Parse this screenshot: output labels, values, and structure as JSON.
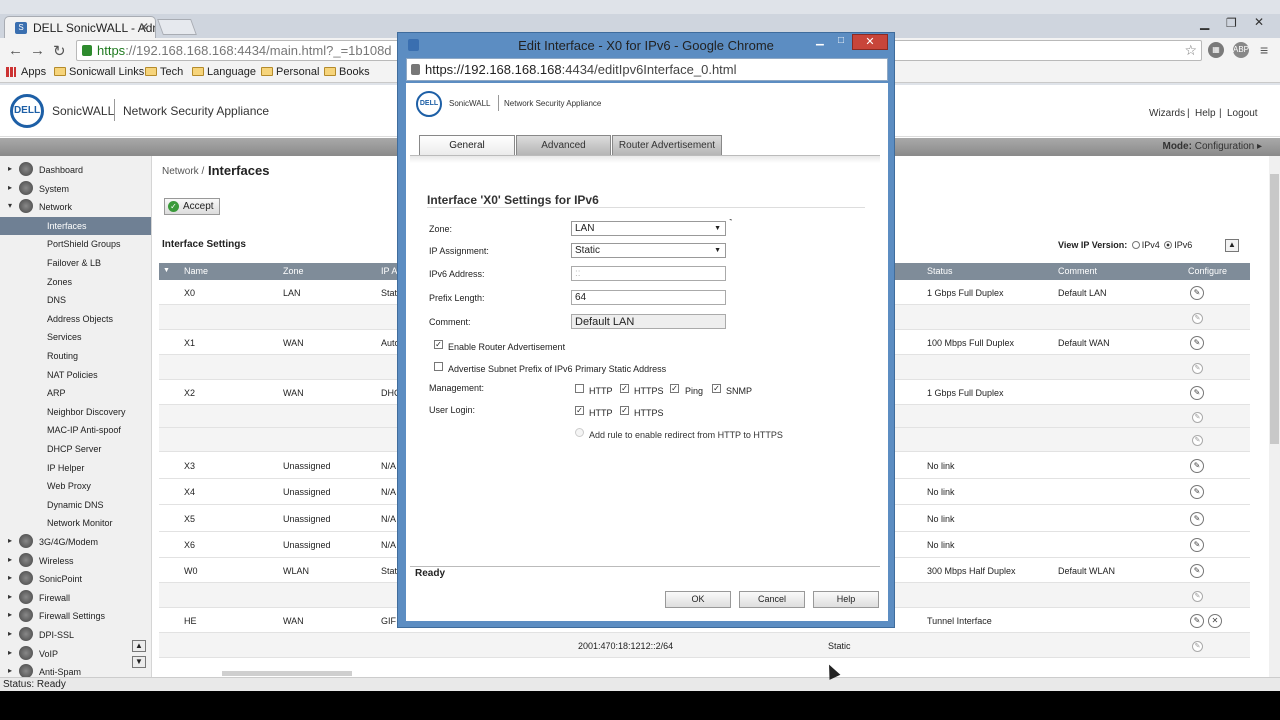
{
  "browser": {
    "tab_title": "DELL SonicWALL - Admin",
    "url_https": "https",
    "url_rest": "://192.168.168.168:4434/main.html?_=1b108d",
    "bookmarks": [
      "Apps",
      "Sonicwall Links",
      "Tech",
      "Language",
      "Personal",
      "Books"
    ]
  },
  "header": {
    "brand": "SonicWALL",
    "app_name": "Network Security Appliance",
    "links": [
      "Wizards",
      "Help",
      "Logout"
    ],
    "mode_label": "Mode:",
    "mode_value": "Configuration ▸"
  },
  "sidebar": {
    "items": [
      {
        "label": "Dashboard",
        "level": "top",
        "arrow": "▸"
      },
      {
        "label": "System",
        "level": "top",
        "arrow": "▸"
      },
      {
        "label": "Network",
        "level": "top",
        "arrow": "▾"
      },
      {
        "label": "Interfaces",
        "level": "sub",
        "selected": true
      },
      {
        "label": "PortShield Groups",
        "level": "sub"
      },
      {
        "label": "Failover & LB",
        "level": "sub"
      },
      {
        "label": "Zones",
        "level": "sub"
      },
      {
        "label": "DNS",
        "level": "sub"
      },
      {
        "label": "Address Objects",
        "level": "sub"
      },
      {
        "label": "Services",
        "level": "sub"
      },
      {
        "label": "Routing",
        "level": "sub"
      },
      {
        "label": "NAT Policies",
        "level": "sub"
      },
      {
        "label": "ARP",
        "level": "sub"
      },
      {
        "label": "Neighbor Discovery",
        "level": "sub"
      },
      {
        "label": "MAC-IP Anti-spoof",
        "level": "sub"
      },
      {
        "label": "DHCP Server",
        "level": "sub"
      },
      {
        "label": "IP Helper",
        "level": "sub"
      },
      {
        "label": "Web Proxy",
        "level": "sub"
      },
      {
        "label": "Dynamic DNS",
        "level": "sub"
      },
      {
        "label": "Network Monitor",
        "level": "sub"
      },
      {
        "label": "3G/4G/Modem",
        "level": "top",
        "arrow": "▸"
      },
      {
        "label": "Wireless",
        "level": "top",
        "arrow": "▸"
      },
      {
        "label": "SonicPoint",
        "level": "top",
        "arrow": "▸"
      },
      {
        "label": "Firewall",
        "level": "top",
        "arrow": "▸"
      },
      {
        "label": "Firewall Settings",
        "level": "top",
        "arrow": "▸"
      },
      {
        "label": "DPI-SSL",
        "level": "top",
        "arrow": "▸"
      },
      {
        "label": "VoIP",
        "level": "top",
        "arrow": "▸"
      },
      {
        "label": "Anti-Spam",
        "level": "top",
        "arrow": "▸"
      }
    ]
  },
  "main": {
    "breadcrumb": "Network /",
    "title": "Interfaces",
    "accept_label": "Accept",
    "section_title": "Interface Settings",
    "view_ip_label": "View IP Version:",
    "ipv4_label": "IPv4",
    "ipv6_label": "IPv6",
    "columns": [
      "Name",
      "Zone",
      "IP A",
      "Status",
      "Comment",
      "Configure"
    ],
    "rows": [
      {
        "name": "X0",
        "zone": "LAN",
        "ip": "Stati",
        "status": "1 Gbps Full Duplex",
        "comment": "Default LAN"
      },
      {
        "name": "",
        "zone": "",
        "ip": "",
        "status": "",
        "comment": ""
      },
      {
        "name": "X1",
        "zone": "WAN",
        "ip": "Auto",
        "status": "100 Mbps Full Duplex",
        "comment": "Default WAN"
      },
      {
        "name": "",
        "zone": "",
        "ip": "",
        "status": "",
        "comment": ""
      },
      {
        "name": "X2",
        "zone": "WAN",
        "ip": "DHC",
        "status": "1 Gbps Full Duplex",
        "comment": ""
      },
      {
        "name": "",
        "zone": "",
        "ip": "",
        "status": "",
        "comment": ""
      },
      {
        "name": "",
        "zone": "",
        "ip": "",
        "status": "",
        "comment": ""
      },
      {
        "name": "X3",
        "zone": "Unassigned",
        "ip": "N/A",
        "status": "No link",
        "comment": ""
      },
      {
        "name": "X4",
        "zone": "Unassigned",
        "ip": "N/A",
        "status": "No link",
        "comment": ""
      },
      {
        "name": "X5",
        "zone": "Unassigned",
        "ip": "N/A",
        "status": "No link",
        "comment": ""
      },
      {
        "name": "X6",
        "zone": "Unassigned",
        "ip": "N/A",
        "status": "No link",
        "comment": ""
      },
      {
        "name": "W0",
        "zone": "WLAN",
        "ip": "Stati",
        "status": "300 Mbps Half Duplex",
        "comment": "Default WLAN"
      },
      {
        "name": "",
        "zone": "",
        "ip": "",
        "status": "",
        "comment": ""
      },
      {
        "name": "HE",
        "zone": "WAN",
        "ip": "GIF",
        "status": "Tunnel Interface",
        "comment": ""
      },
      {
        "name": "",
        "zone": "",
        "ip": "2001:470:18:1212::2/64",
        "status": "Static",
        "comment": ""
      }
    ]
  },
  "status_bar": "Status: Ready",
  "popup": {
    "title": "Edit Interface - X0 for IPv6 - Google Chrome",
    "url_host": "https://192.168.168.168",
    "url_rest": ":4434/editIpv6Interface_0.html",
    "brand": "SonicWALL",
    "app_name": "Network Security Appliance",
    "tabs": [
      "General",
      "Advanced",
      "Router Advertisement"
    ],
    "settings_title": "Interface 'X0' Settings for IPv6",
    "zone_label": "Zone:",
    "zone_value": "LAN",
    "ip_assignment_label": "IP Assignment:",
    "ip_assignment_value": "Static",
    "ipv6_address_label": "IPv6 Address:",
    "ipv6_address_value": "::",
    "prefix_label": "Prefix Length:",
    "prefix_value": "64",
    "comment_label": "Comment:",
    "comment_value": "Default LAN",
    "enable_ra_label": "Enable Router Advertisement",
    "advertise_label": "Advertise Subnet Prefix of IPv6 Primary Static Address",
    "management_label": "Management:",
    "mgmt_http": "HTTP",
    "mgmt_https": "HTTPS",
    "mgmt_ping": "Ping",
    "mgmt_snmp": "SNMP",
    "user_login_label": "User Login:",
    "ul_http": "HTTP",
    "ul_https": "HTTPS",
    "redirect_label": "Add rule to enable redirect from HTTP to HTTPS",
    "status": "Ready",
    "ok_label": "OK",
    "cancel_label": "Cancel",
    "help_label": "Help"
  }
}
